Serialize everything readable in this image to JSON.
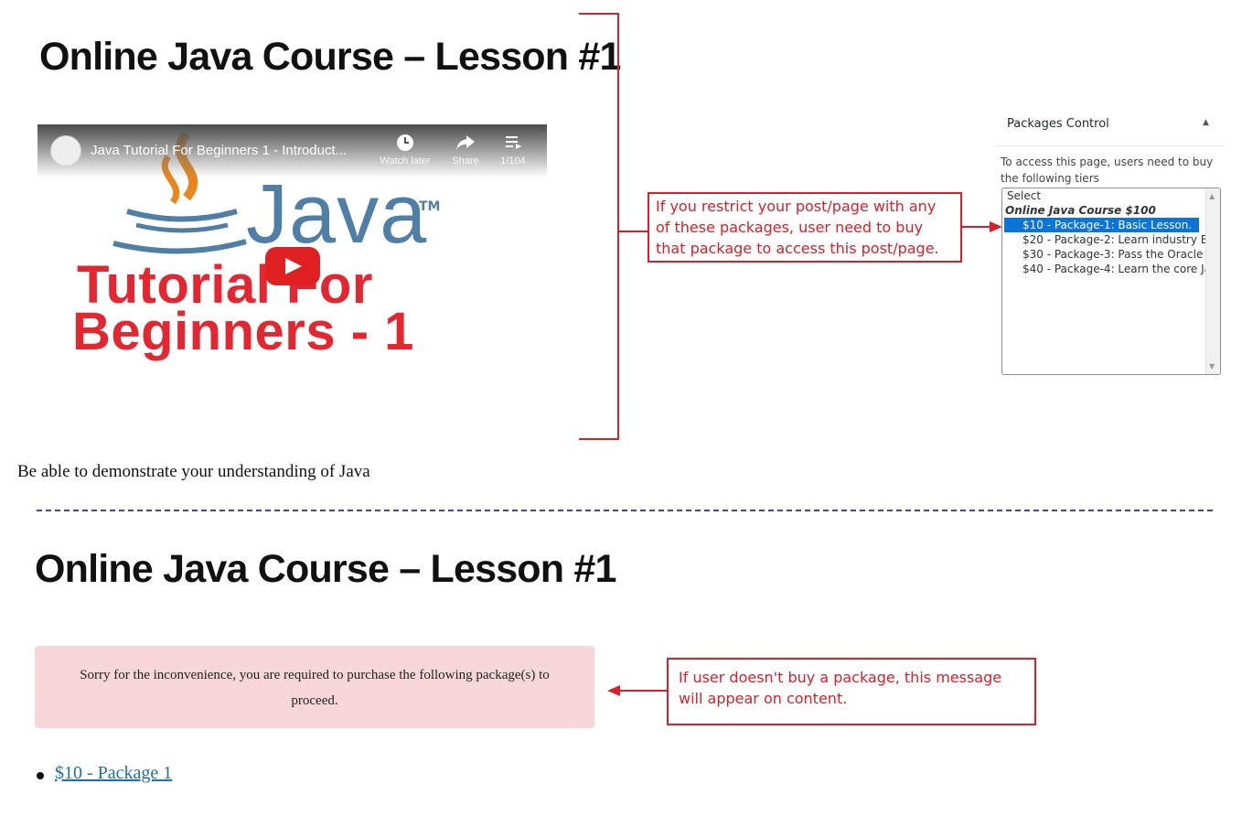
{
  "lesson": {
    "title": "Online Java Course – Lesson #1"
  },
  "video": {
    "title": "Java Tutorial For Beginners 1 - Introduct...",
    "watch_later_label": "Watch later",
    "share_label": "Share",
    "playlist_count": "1/104",
    "thumbnail": {
      "java_text": "Java",
      "trademark": "TM",
      "line1": "Tutorial For",
      "line2": "Beginners - 1"
    }
  },
  "description": "Be able to demonstrate your understanding of Java",
  "callouts": {
    "restrict": "If you restrict your post/page with any of these packages, user need to buy that package to access this post/page.",
    "message": "If user doesn't buy a package, this message will appear on content."
  },
  "packages_control": {
    "title": "Packages Control",
    "description": "To access this page, users need to buy the following tiers",
    "options": {
      "placeholder": "Select",
      "group": "Online Java Course $100",
      "items": [
        "$10 - Package-1: Basic Lesson.",
        "$20 - Package-2: Learn industry Be",
        "$30 - Package-3: Pass the Oracle J",
        "$40 - Package-4: Learn the core Ja"
      ]
    }
  },
  "restriction_notice": {
    "message": "Sorry for the inconvenience, you are required to purchase the following package(s) to proceed.",
    "packages": [
      "$10 - Package 1"
    ]
  },
  "colors": {
    "annotation": "#d6202a",
    "selected": "#0a74d8",
    "notice_bg": "#f8d7da",
    "link": "#1e6fa8",
    "divider": "#3b42c4"
  }
}
